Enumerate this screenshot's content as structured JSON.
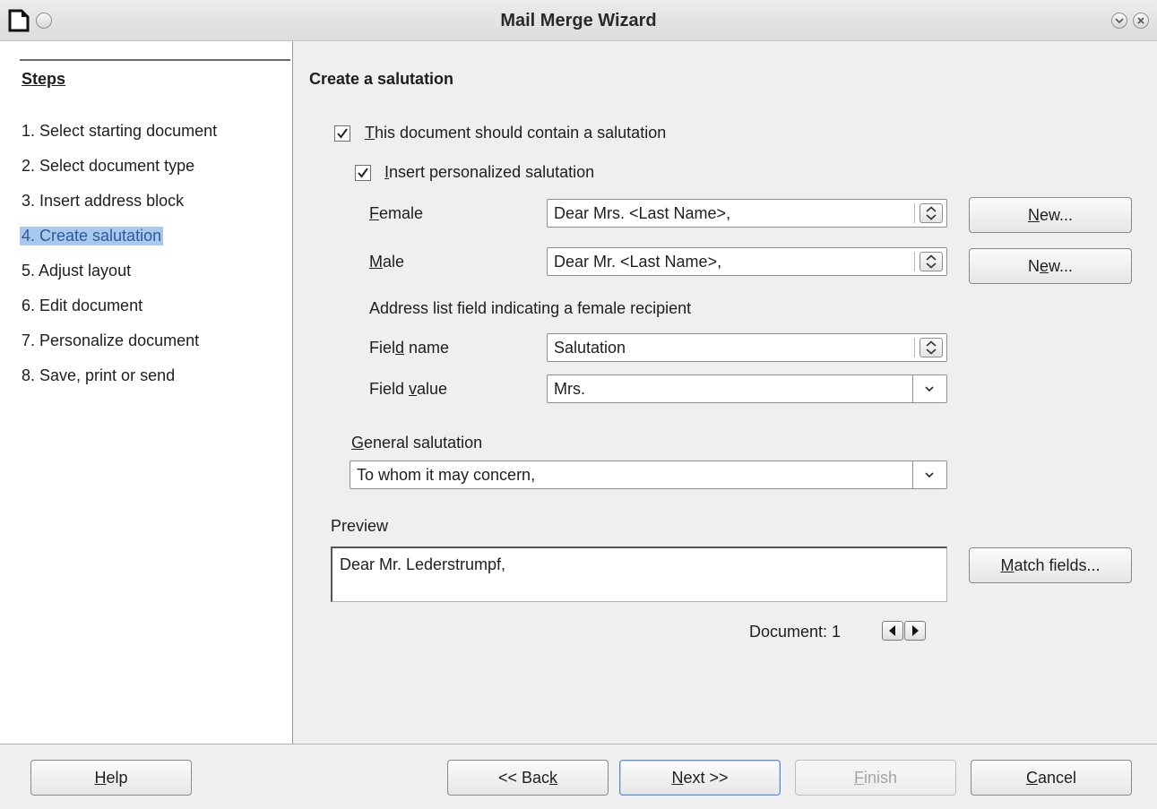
{
  "window": {
    "title": "Mail Merge Wizard"
  },
  "steps": {
    "heading": "Steps",
    "items": [
      {
        "label": "1. Select starting document"
      },
      {
        "label": "2. Select document type"
      },
      {
        "label": "3. Insert address block"
      },
      {
        "label": "4. Create salutation",
        "current": true
      },
      {
        "label": "5. Adjust layout"
      },
      {
        "label": "6. Edit document"
      },
      {
        "label": "7. Personalize document"
      },
      {
        "label": "8. Save, print or send"
      }
    ]
  },
  "page": {
    "title": "Create a salutation",
    "contain_salutation": {
      "label_first": "T",
      "label_rest": "his document should contain a salutation",
      "checked": true
    },
    "personalized": {
      "label_first": "I",
      "label_rest": "nsert personalized salutation",
      "checked": true
    },
    "female": {
      "label_first": "F",
      "label_rest": "emale",
      "value": "Dear Mrs. <Last Name>,",
      "new_before": "",
      "new_mn": "N",
      "new_after": "ew..."
    },
    "male": {
      "label_first": "M",
      "label_rest": "ale",
      "value": "Dear Mr. <Last Name>,",
      "new_before": "N",
      "new_mn": "e",
      "new_after": "w..."
    },
    "address_field_heading": "Address list field indicating a female recipient",
    "field_name": {
      "label_before": "Fiel",
      "label_mn": "d",
      "label_after": " name",
      "value": "Salutation"
    },
    "field_value": {
      "label_before": "Field ",
      "label_mn": "v",
      "label_after": "alue",
      "value": "Mrs."
    },
    "general": {
      "label_first": "G",
      "label_rest": "eneral salutation",
      "value": "To whom it may concern,"
    },
    "preview": {
      "label": "Preview",
      "text": "Dear Mr. Lederstrumpf,",
      "match_mn": "M",
      "match_rest": "atch fields..."
    },
    "document_counter": "Document: 1"
  },
  "footer": {
    "help": {
      "mn": "H",
      "rest": "elp"
    },
    "back": {
      "before": "<< Bac",
      "mn": "k",
      "after": ""
    },
    "next": {
      "before": "",
      "mn": "N",
      "after": "ext >>"
    },
    "finish": {
      "before": "",
      "mn": "F",
      "after": "inish"
    },
    "cancel": {
      "before": "",
      "mn": "C",
      "after": "ancel"
    }
  }
}
